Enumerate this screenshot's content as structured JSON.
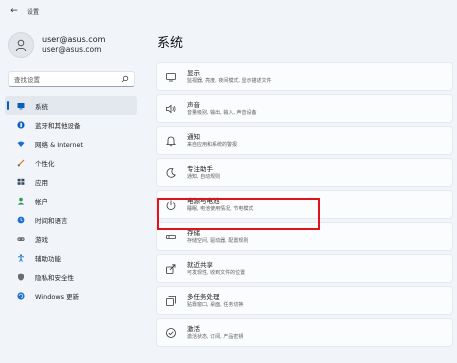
{
  "window": {
    "title": "设置",
    "back_glyph": "←"
  },
  "profile": {
    "name": "user@asus.com",
    "email": "user@asus.com"
  },
  "search": {
    "placeholder": "查找设置"
  },
  "nav": [
    {
      "label": "系统",
      "icon": "monitor-icon",
      "color": "#0b5cbf",
      "selected": true
    },
    {
      "label": "蓝牙和其他设备",
      "icon": "bluetooth-icon",
      "color": "#0b5cbf"
    },
    {
      "label": "网络 & Internet",
      "icon": "wifi-icon",
      "color": "#1d6fd1"
    },
    {
      "label": "个性化",
      "icon": "brush-icon",
      "color": "#c77b2a"
    },
    {
      "label": "应用",
      "icon": "apps-icon",
      "color": "#3a4a5e"
    },
    {
      "label": "帐户",
      "icon": "person-icon",
      "color": "#2e9a5a"
    },
    {
      "label": "时间和语言",
      "icon": "globe-clock-icon",
      "color": "#1d6fd1"
    },
    {
      "label": "游戏",
      "icon": "gamepad-icon",
      "color": "#6b6b6b"
    },
    {
      "label": "辅助功能",
      "icon": "accessibility-icon",
      "color": "#1d6fd1"
    },
    {
      "label": "隐私和安全性",
      "icon": "shield-icon",
      "color": "#6b6b6b"
    },
    {
      "label": "Windows 更新",
      "icon": "update-icon",
      "color": "#1d6fd1"
    }
  ],
  "main": {
    "title": "系统",
    "cards": [
      {
        "title": "显示",
        "subtitle": "监视器, 亮度, 夜间模式, 显示描述文件",
        "icon": "display-icon"
      },
      {
        "title": "声音",
        "subtitle": "音量级别, 输出, 输入, 声音设备",
        "icon": "speaker-icon"
      },
      {
        "title": "通知",
        "subtitle": "来自应用和系统的警报",
        "icon": "bell-icon"
      },
      {
        "title": "专注助手",
        "subtitle": "通知, 自动规则",
        "icon": "moon-icon"
      },
      {
        "title": "电源与电池",
        "subtitle": "睡眠, 电池使用情况, 节电模式",
        "icon": "power-icon"
      },
      {
        "title": "存储",
        "subtitle": "存储空间, 驱动器, 配置规则",
        "icon": "storage-icon"
      },
      {
        "title": "就近共享",
        "subtitle": "可发现性, 收到文件的位置",
        "icon": "share-icon"
      },
      {
        "title": "多任务处理",
        "subtitle": "贴靠窗口, 桌面, 任务切换",
        "icon": "multitask-icon"
      },
      {
        "title": "激活",
        "subtitle": "激活状态, 订阅, 产品密钥",
        "icon": "check-circle-icon"
      }
    ]
  },
  "highlight_color": "#e0121b"
}
